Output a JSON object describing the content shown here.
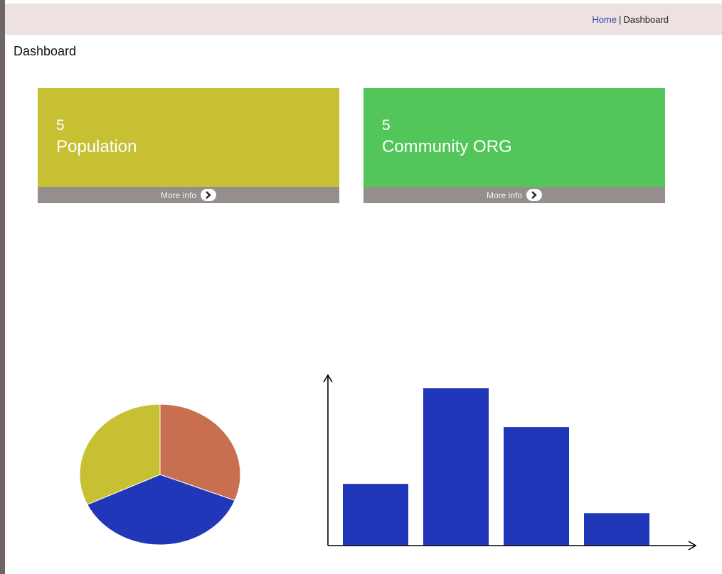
{
  "header": {
    "breadcrumb_home": "Home",
    "breadcrumb_sep": "|",
    "breadcrumb_current": "Dashboard"
  },
  "page": {
    "title": "Dashboard"
  },
  "cards": [
    {
      "count": "5",
      "label": "Population",
      "more": "More info",
      "color": "#c6c032"
    },
    {
      "count": "5",
      "label": "Community ORG",
      "more": "More info",
      "color": "#52c65a"
    }
  ],
  "colors": {
    "blue": "#2037b9",
    "orange": "#c86f4f",
    "olive": "#c6c032"
  },
  "chart_data": [
    {
      "type": "pie",
      "values": [
        31,
        37,
        32
      ],
      "colors": [
        "#c86f4f",
        "#2037b9",
        "#c6c032"
      ]
    },
    {
      "type": "bar",
      "values": [
        38,
        97,
        73,
        20
      ],
      "ylim": [
        0,
        105
      ],
      "bar_color": "#2037b9",
      "grid": false
    }
  ]
}
